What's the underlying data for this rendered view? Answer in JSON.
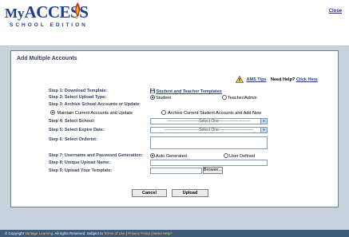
{
  "header": {
    "logo_prefix": "My",
    "logo_main": "ACCESS",
    "logo_sub": "SCHOOL EDITION",
    "close_label": "Close"
  },
  "panel": {
    "title": "Add Multiple Accounts"
  },
  "help": {
    "ams_tips": "AMS Tips",
    "need_help": "Need Help?",
    "click_here": "Click Here"
  },
  "form": {
    "step1": {
      "label": "Step 1: Download Template:",
      "link": "Student and Teacher Templates"
    },
    "step2": {
      "label": "Step 2: Select Upload Type:",
      "option_student": "Student",
      "option_teacher": "Teacher/Admin",
      "selected": "Student"
    },
    "step3": {
      "label": "Step 3: Archive School Accounts or Update:",
      "option_maintain": "Maintain Current Accounts and Update",
      "option_archive": "Archive Current Student Accounts and Add New",
      "selected": "Maintain Current Accounts and Update"
    },
    "step4": {
      "label": "Step 4: Select School:",
      "value": "------------------------Select One------------------------"
    },
    "step5": {
      "label": "Step 5: Select Expire Date:",
      "value": "--------------------------Select One--------------------------"
    },
    "step6": {
      "label": "Step 6: Select Orderist:"
    },
    "step7": {
      "label": "Step 7: Username and Password Generation:",
      "option_auto": "Auto Generated",
      "option_user": "User Defined",
      "selected": "Auto Generated"
    },
    "step8": {
      "label": "Step 8: Unique Upload Name:",
      "value": ""
    },
    "step9": {
      "label": "Step 9: Upload Your Template:",
      "browse_label": "Browse..."
    }
  },
  "actions": {
    "cancel_label": "Cancel",
    "upload_label": "Upload"
  },
  "footer": {
    "copyright": "© Copyright",
    "company": "Vantage Learning",
    "rights": ". All rights Reserved. Subject to",
    "terms": "Terms of Use",
    "privacy": "Privacy Policy",
    "need_help": "Need Help?",
    "sep": " | "
  },
  "colors": {
    "brand_blue": "#1d3f8f",
    "label_navy": "#33415c",
    "flame_red": "#d32f2f",
    "flame_yellow": "#f4b400",
    "warning_yellow": "#f7d23e",
    "band_gray": "#c8d2dc",
    "footer_bg": "#3f5a7a"
  }
}
